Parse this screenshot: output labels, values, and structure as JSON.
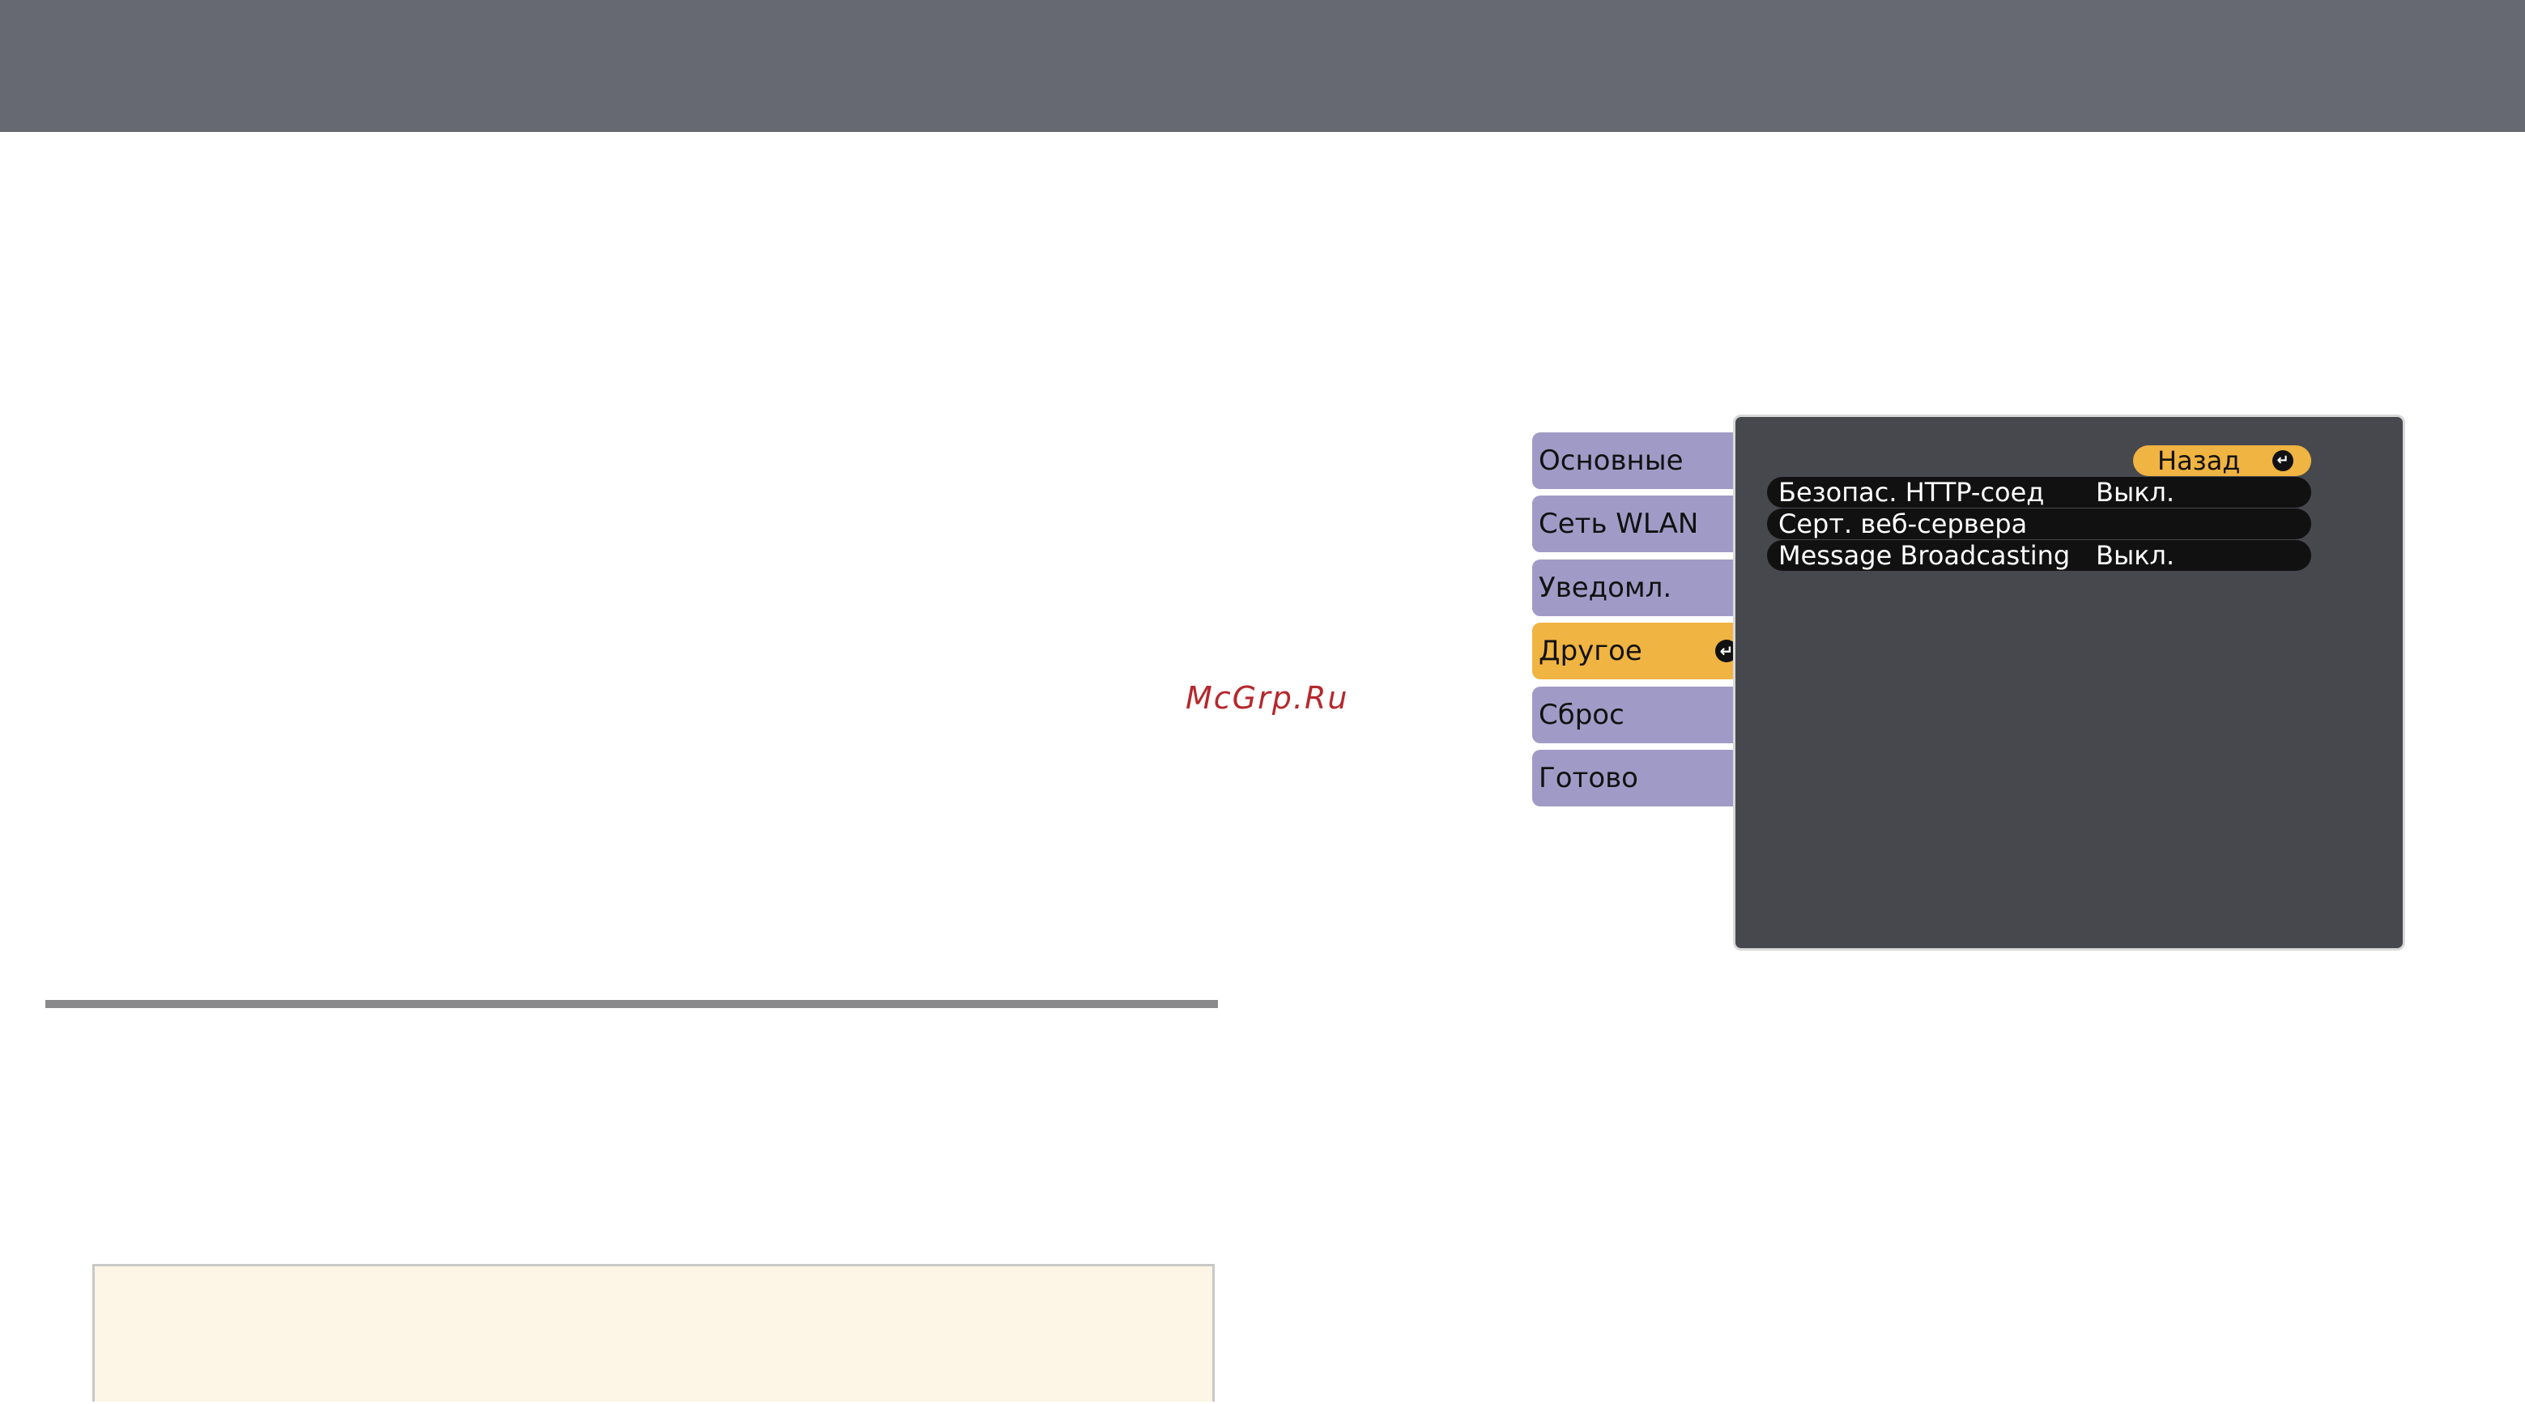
{
  "watermark": "McGrp.Ru",
  "menu": {
    "tabs": [
      {
        "label": "Основные",
        "active": false
      },
      {
        "label": "Сеть WLAN",
        "active": false
      },
      {
        "label": "Уведомл.",
        "active": false
      },
      {
        "label": "Другое",
        "active": true
      },
      {
        "label": "Сброс",
        "active": false
      },
      {
        "label": "Готово",
        "active": false
      }
    ],
    "back_label": "Назад",
    "enter_icon": "enter-icon",
    "rows": [
      {
        "label": "Безопас. HTTP-соед",
        "value": "Выкл."
      },
      {
        "label": "Серт. веб-сервера",
        "value": ""
      },
      {
        "label": "Message Broadcasting",
        "value": "Выкл."
      }
    ],
    "colors": {
      "tab_bg": "#a09bc6",
      "active_tab_bg": "#f0b442",
      "panel_bg": "#47484d",
      "row_bg": "#111111"
    }
  }
}
